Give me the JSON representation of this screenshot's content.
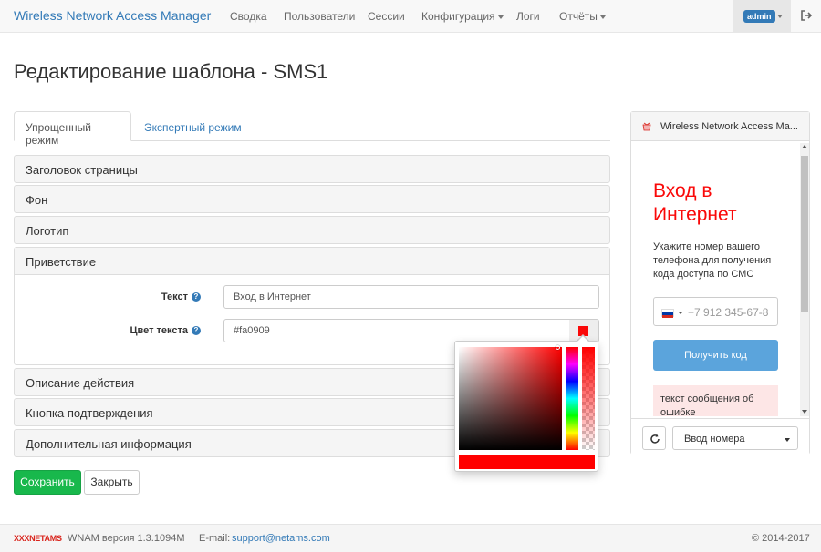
{
  "navbar": {
    "brand": "Wireless Network Access Manager",
    "items": [
      {
        "label": "Сводка",
        "dropdown": false
      },
      {
        "label": "Пользователи",
        "dropdown": false
      },
      {
        "label": "Сессии",
        "dropdown": false
      },
      {
        "label": "Конфигурация",
        "dropdown": true
      },
      {
        "label": "Логи",
        "dropdown": false
      },
      {
        "label": "Отчёты",
        "dropdown": true
      }
    ],
    "user_badge": "admin",
    "logout_icon": "sign-out-icon"
  },
  "page": {
    "title": "Редактирование шаблона - SMS1"
  },
  "tabs": [
    {
      "label": "Упрощенный режим",
      "active": true
    },
    {
      "label": "Экспертный режим",
      "active": false
    }
  ],
  "panels": {
    "header": "Заголовок страницы",
    "background": "Фон",
    "logo": "Логотип",
    "greeting": "Приветствие",
    "action_description": "Описание действия",
    "confirm_button": "Кнопка подтверждения",
    "additional_info": "Дополнительная информация"
  },
  "greeting_form": {
    "text_label": "Текст",
    "text_value": "Вход в Интернет",
    "color_label": "Цвет текста",
    "color_value": "#fa0909",
    "help_icon": "question-circle-icon"
  },
  "actions": {
    "save_label": "Сохранить",
    "close_label": "Закрыть"
  },
  "preview": {
    "window_title": "Wireless Network Access Ma...",
    "heading": "Вход в Интернет",
    "description": "Укажите номер вашего телефона для получения кода доступа по СМС",
    "phone_placeholder": "+7 912 345-67-8",
    "get_code_label": "Получить код",
    "error_text": "текст сообщения об ошибке",
    "mode_select_value": "Ввод номера",
    "refresh_icon": "refresh-icon"
  },
  "footer": {
    "logo_text": "NETAMS",
    "version": "WNAM версия 1.3.1094M",
    "email_label": "E-mail:",
    "email": "support@netams.com",
    "copyright": "© 2014-2017"
  },
  "colors": {
    "brand": "#337ab7",
    "save_button": "#18b84c",
    "heading_text": "#fa0909",
    "get_code_button": "#5ba4dc"
  }
}
